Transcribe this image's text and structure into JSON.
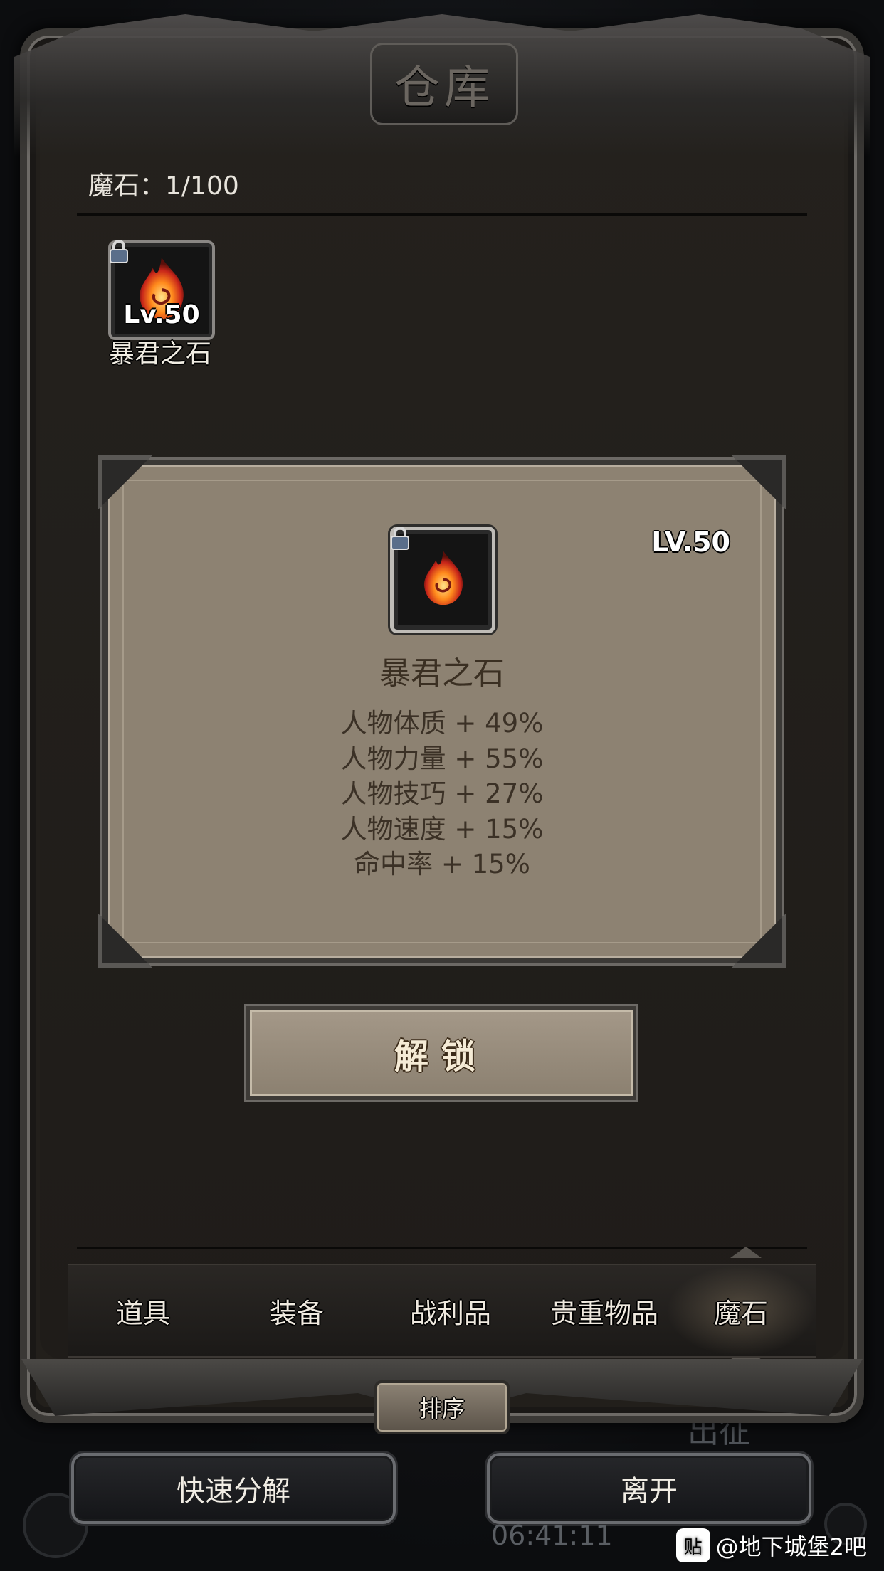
{
  "window": {
    "title": "仓库"
  },
  "inventory": {
    "count_label": "魔石：1/100"
  },
  "items": [
    {
      "name": "暴君之石",
      "level": "Lv.50",
      "icon": "fire-stone-icon",
      "locked": true
    }
  ],
  "detail": {
    "icon": "fire-stone-icon",
    "level": "LV.50",
    "name": "暴君之石",
    "stats": [
      "人物体质 + 49%",
      "人物力量 + 55%",
      "人物技巧 + 27%",
      "人物速度 + 15%",
      "命中率 + 15%"
    ]
  },
  "unlock_button": {
    "label": "解锁"
  },
  "tabs": [
    {
      "label": "道具",
      "active": false
    },
    {
      "label": "装备",
      "active": false
    },
    {
      "label": "战利品",
      "active": false
    },
    {
      "label": "贵重物品",
      "active": false
    },
    {
      "label": "魔石",
      "active": true
    }
  ],
  "sort_button": {
    "label": "排序"
  },
  "actions": {
    "quick_disassemble": "快速分解",
    "leave": "离开"
  },
  "background_hud": {
    "sortie": "出征",
    "timer": "06:41:11"
  },
  "watermark": {
    "logo": "贴",
    "text": "@地下城堡2吧"
  },
  "colors": {
    "panel": "#221f1b",
    "card": "#8d8272",
    "accent_text": "#f0ece2"
  }
}
